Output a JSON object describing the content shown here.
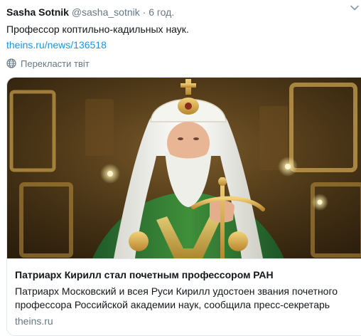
{
  "tweet": {
    "author_name": "Sasha Sotnik",
    "handle": "@sasha_sotnik",
    "separator": "·",
    "time": "6 год.",
    "text": "Профессор коптильно-кадильных наук.",
    "link_text": "theins.ru/news/136518",
    "translate_label": "Перекласти твіт"
  },
  "card": {
    "title": "Патриарх Кирилл стал почетным профессором РАН",
    "description": "Патриарх Московский и всея Руси Кирилл удостоен звания почетного профессора Российской академии наук, сообщила  пресс-секретарь",
    "domain": "theins.ru"
  },
  "icons": {
    "menu": "chevron-down-icon",
    "translate": "globe-icon"
  },
  "colors": {
    "link": "#1b95e0",
    "secondary_text": "#657786",
    "border": "#e1e8ed"
  }
}
